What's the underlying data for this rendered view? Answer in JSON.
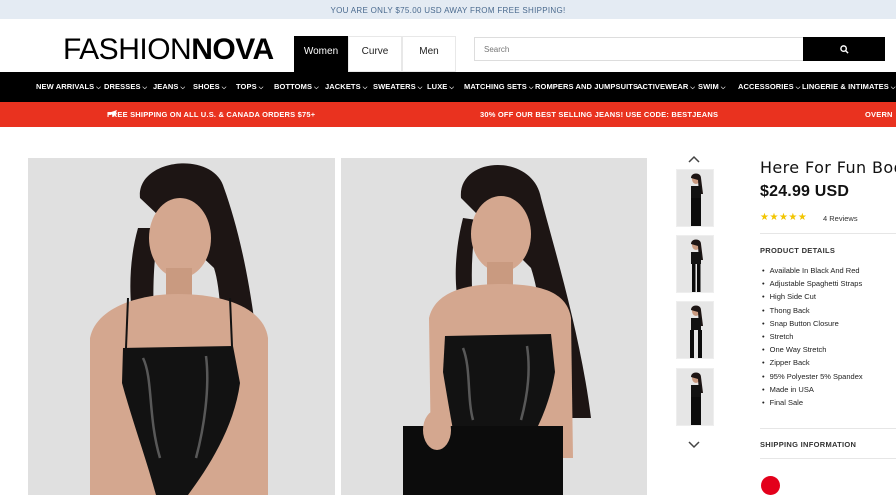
{
  "announcement": "YOU ARE ONLY $75.00 USD AWAY FROM FREE SHIPPING!",
  "brand": {
    "light": "FASHION",
    "bold": "NOVA"
  },
  "tabs": [
    {
      "label": "Women",
      "active": true
    },
    {
      "label": "Curve",
      "active": false
    },
    {
      "label": "Men",
      "active": false
    }
  ],
  "search": {
    "placeholder": "Search",
    "button_icon": "search-icon"
  },
  "nav": [
    {
      "label": "NEW ARRIVALS"
    },
    {
      "label": "DRESSES"
    },
    {
      "label": "JEANS"
    },
    {
      "label": "SHOES"
    },
    {
      "label": "TOPS"
    },
    {
      "label": "BOTTOMS"
    },
    {
      "label": "JACKETS"
    },
    {
      "label": "SWEATERS"
    },
    {
      "label": "LUXE"
    },
    {
      "label": "MATCHING SETS"
    },
    {
      "label": "ROMPERS AND JUMPSUITS"
    },
    {
      "label": "ACTIVEWEAR"
    },
    {
      "label": "SWIM"
    },
    {
      "label": "ACCESSORIES"
    },
    {
      "label": "LINGERIE & INTIMATES"
    }
  ],
  "promo": {
    "left": "FREE SHIPPING ON ALL U.S. & CANADA ORDERS $75+",
    "center": "30% OFF OUR BEST SELLING JEANS! USE CODE: BESTJEANS",
    "right": "OVERN"
  },
  "product": {
    "title": "Here For Fun Bod",
    "price": "$24.99 USD",
    "rating": 5,
    "reviews": "4 Reviews",
    "details_heading": "PRODUCT DETAILS",
    "details": [
      "Available In Black And Red",
      "Adjustable Spaghetti Straps",
      "High Side Cut",
      "Thong Back",
      "Snap Button Closure",
      "Stretch",
      "One Way Stretch",
      "Zipper Back",
      "95% Polyester 5% Spandex",
      "Made in USA",
      "Final Sale"
    ],
    "shipping_heading": "SHIPPING INFORMATION",
    "color_swatch": "#e3001b"
  },
  "colors": {
    "accent_red": "#e9321f",
    "nav_bg": "#000000",
    "announcement_bg": "#e4ebf3"
  }
}
